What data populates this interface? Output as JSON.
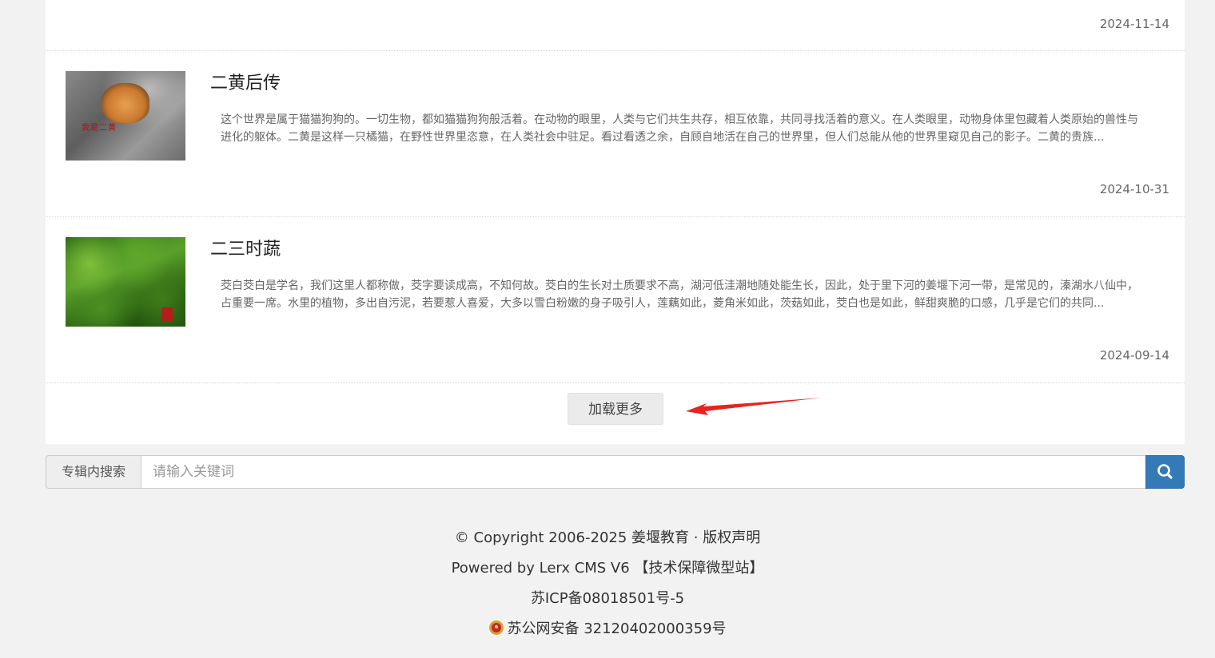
{
  "list": {
    "top_date": "2024-11-14",
    "items": [
      {
        "title": "二黄后传",
        "thumb_alt_text": "我是二黄",
        "desc": "这个世界是属于猫猫狗狗的。一切生物，都如猫猫狗狗般活着。在动物的眼里，人类与它们共生共存，相互依靠，共同寻找活着的意义。在人类眼里，动物身体里包藏着人类原始的兽性与进化的躯体。二黄是这样一只橘猫，在野性世界里恣意，在人类社会中驻足。看过看透之余，自顾自地活在自己的世界里，但人们总能从他的世界里窥见自己的影子。二黄的贵族...",
        "date": "2024-10-31"
      },
      {
        "title": "二三时蔬",
        "desc": "茭白茭白是学名，我们这里人都称做，茭字要读成高，不知何故。茭白的生长对土质要求不高，湖河低洼潮地随处能生长，因此，处于里下河的姜堰下河一带，是常见的，溱湖水八仙中，占重要一席。水里的植物，多出自污泥，若要惹人喜爱，大多以雪白粉嫩的身子吸引人，莲藕如此，菱角米如此，茨菇如此，茭白也是如此，鲜甜爽脆的口感，几乎是它们的共同...",
        "date": "2024-09-14"
      }
    ],
    "load_more_label": "加载更多"
  },
  "search": {
    "label": "专辑内搜索",
    "placeholder": "请输入关键词",
    "button_icon": "search-icon"
  },
  "footer": {
    "copyright": "© Copyright 2006-2025 姜堰教育 · 版权声明",
    "powered": "Powered by Lerx CMS V6 【技术保障微型站】",
    "icp": "苏ICP备08018501号-5",
    "police": "苏公网安备 32120402000359号"
  },
  "colors": {
    "accent": "#337ab7",
    "arrow": "#e8231e"
  }
}
